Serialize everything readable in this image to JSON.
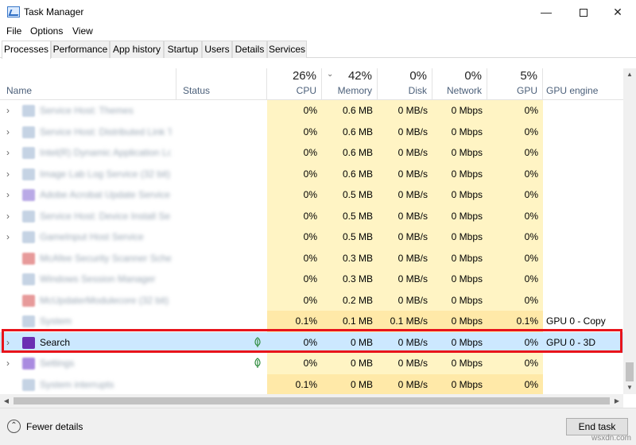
{
  "window": {
    "title": "Task Manager",
    "min": "—",
    "close": "✕"
  },
  "menu": [
    "File",
    "Options",
    "View"
  ],
  "tabs": [
    "Processes",
    "Performance",
    "App history",
    "Startup",
    "Users",
    "Details",
    "Services"
  ],
  "active_tab": "Processes",
  "columns": {
    "name": "Name",
    "status": "Status",
    "cpu": {
      "pct": "26%",
      "label": "CPU"
    },
    "memory": {
      "pct": "42%",
      "label": "Memory"
    },
    "disk": {
      "pct": "0%",
      "label": "Disk"
    },
    "network": {
      "pct": "0%",
      "label": "Network"
    },
    "gpu": {
      "pct": "5%",
      "label": "GPU"
    },
    "gpu_engine": "GPU engine"
  },
  "rows": [
    {
      "name": "Service Host: Themes",
      "cpu": "0%",
      "mem": "0.6 MB",
      "disk": "0 MB/s",
      "net": "0 Mbps",
      "gpu": "0%",
      "engine": ""
    },
    {
      "name": "Service Host: Distributed Link Tr...",
      "cpu": "0%",
      "mem": "0.6 MB",
      "disk": "0 MB/s",
      "net": "0 Mbps",
      "gpu": "0%",
      "engine": ""
    },
    {
      "name": "Intel(R) Dynamic Application Lo...",
      "cpu": "0%",
      "mem": "0.6 MB",
      "disk": "0 MB/s",
      "net": "0 Mbps",
      "gpu": "0%",
      "engine": ""
    },
    {
      "name": "Image Lab Log Service (32 bit)",
      "cpu": "0%",
      "mem": "0.6 MB",
      "disk": "0 MB/s",
      "net": "0 Mbps",
      "gpu": "0%",
      "engine": ""
    },
    {
      "name": "Adobe Acrobat Update Service (...",
      "cpu": "0%",
      "mem": "0.5 MB",
      "disk": "0 MB/s",
      "net": "0 Mbps",
      "gpu": "0%",
      "engine": ""
    },
    {
      "name": "Service Host: Device Install Serv...",
      "cpu": "0%",
      "mem": "0.5 MB",
      "disk": "0 MB/s",
      "net": "0 Mbps",
      "gpu": "0%",
      "engine": ""
    },
    {
      "name": "GameInput Host Service",
      "cpu": "0%",
      "mem": "0.5 MB",
      "disk": "0 MB/s",
      "net": "0 Mbps",
      "gpu": "0%",
      "engine": ""
    },
    {
      "name": "McAfee Security Scanner Sched...",
      "cpu": "0%",
      "mem": "0.3 MB",
      "disk": "0 MB/s",
      "net": "0 Mbps",
      "gpu": "0%",
      "engine": ""
    },
    {
      "name": "Windows Session Manager",
      "cpu": "0%",
      "mem": "0.3 MB",
      "disk": "0 MB/s",
      "net": "0 Mbps",
      "gpu": "0%",
      "engine": ""
    },
    {
      "name": "McUpdaterModulecore (32 bit)",
      "cpu": "0%",
      "mem": "0.2 MB",
      "disk": "0 MB/s",
      "net": "0 Mbps",
      "gpu": "0%",
      "engine": ""
    },
    {
      "name": "System",
      "cpu": "0.1%",
      "mem": "0.1 MB",
      "disk": "0.1 MB/s",
      "net": "0 Mbps",
      "gpu": "0.1%",
      "engine": "GPU 0 - Copy"
    },
    {
      "name": "Search",
      "cpu": "0%",
      "mem": "0 MB",
      "disk": "0 MB/s",
      "net": "0 Mbps",
      "gpu": "0%",
      "engine": "GPU 0 - 3D"
    },
    {
      "name": "Settings",
      "cpu": "0%",
      "mem": "0 MB",
      "disk": "0 MB/s",
      "net": "0 Mbps",
      "gpu": "0%",
      "engine": ""
    },
    {
      "name": "System interrupts",
      "cpu": "0.1%",
      "mem": "0 MB",
      "disk": "0 MB/s",
      "net": "0 Mbps",
      "gpu": "0%",
      "engine": ""
    }
  ],
  "footer": {
    "fewer_details": "Fewer details",
    "end_task": "End task"
  },
  "watermark": "wsxdn.com",
  "colors": {
    "heat_light": "#fff4c4",
    "heat_medium": "#ffe9a8",
    "selected_row": "#cce8ff",
    "highlight_box": "#e8141b",
    "header_label": "#4c607a"
  }
}
